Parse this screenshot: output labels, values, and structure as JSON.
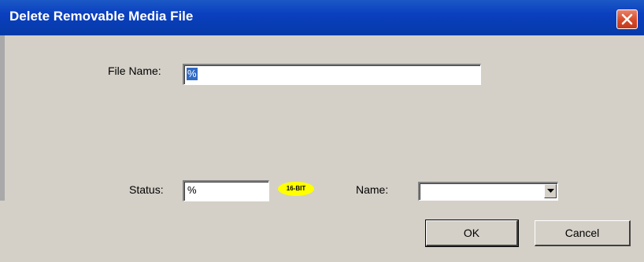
{
  "window": {
    "title": "Delete Removable Media File"
  },
  "form": {
    "file_name_label": "File Name:",
    "file_name_value": "%",
    "status_label": "Status:",
    "status_value": "%",
    "badge_text": "16-BIT",
    "name_label": "Name:",
    "name_value": ""
  },
  "buttons": {
    "ok": "OK",
    "cancel": "Cancel"
  },
  "icons": {
    "close": "close-icon",
    "dropdown": "chevron-down-icon"
  },
  "colors": {
    "titlebar": "#0a3fbf",
    "close_button": "#d44b2a",
    "badge": "#ffff00",
    "selection": "#316ac5"
  }
}
